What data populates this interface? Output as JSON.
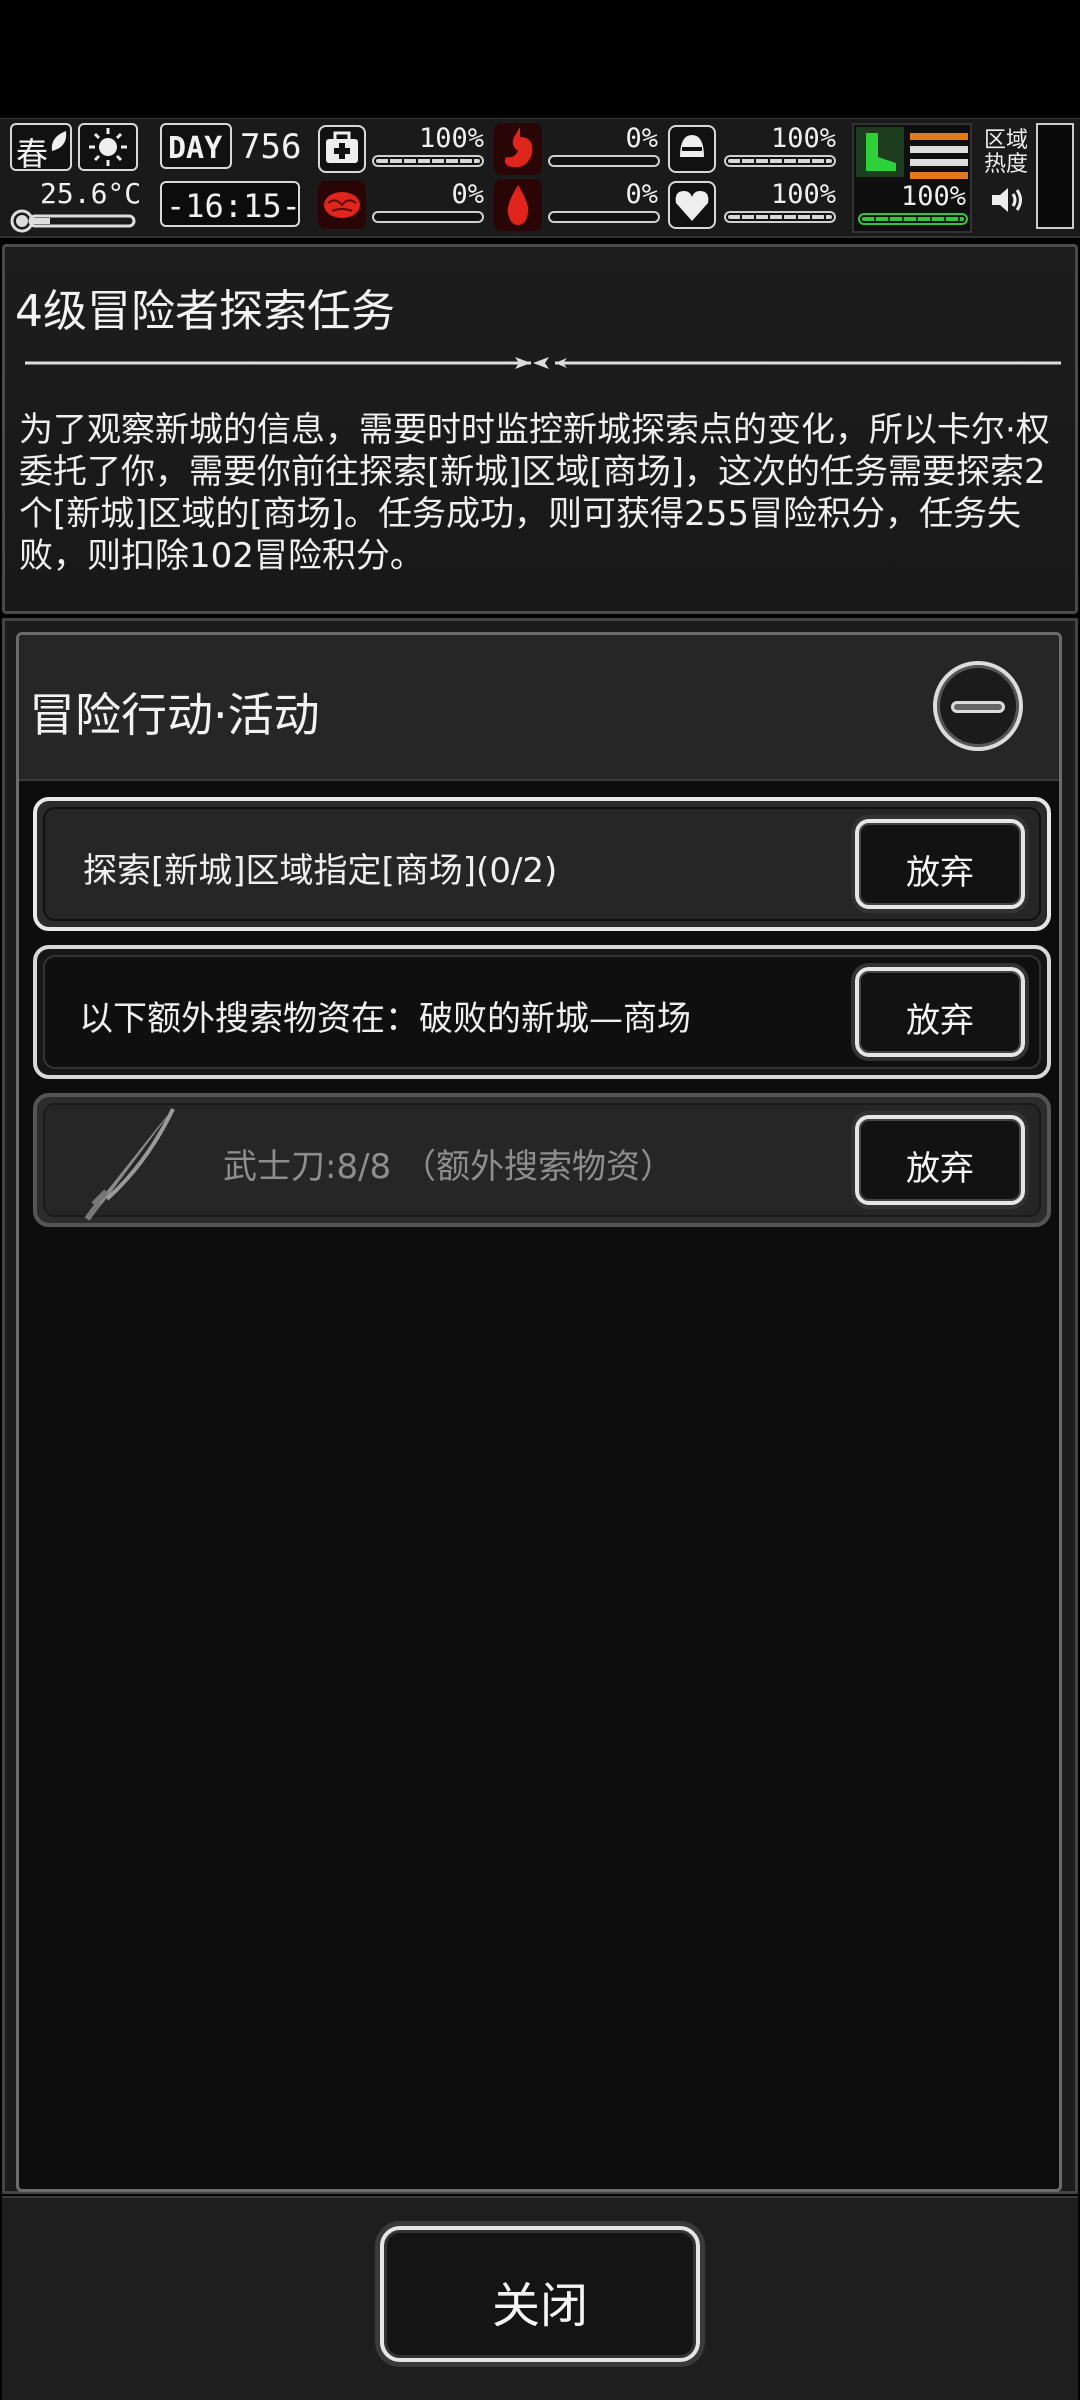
{
  "hud": {
    "season": "春",
    "day_badge": "DAY",
    "day": "756",
    "temperature": "25.6°C",
    "time": "-16:15-",
    "region_heat": "区域\n热度",
    "stats": {
      "health": "100%",
      "sanity": "0%",
      "hunger": "0%",
      "bleeding": "0%",
      "armor": "100%",
      "mood": "100%",
      "stamina": "100%"
    },
    "levels": {
      "health": 1.0,
      "sanity": 0.0,
      "hunger": 0.0,
      "bleeding": 0.0,
      "armor": 1.0,
      "mood": 1.0,
      "stamina": 1.0
    },
    "colors": {
      "red_icon": "#e0261c",
      "green_icon": "#2fd13a",
      "orange_bar": "#e07a1a",
      "accent_text": "#f2f2f2"
    },
    "icons": [
      "leaf-icon",
      "sun-icon",
      "thermometer-icon",
      "medkit-icon",
      "brain-icon",
      "stomach-icon",
      "blood-drop-icon",
      "helmet-icon",
      "heart-icon",
      "boot-icon",
      "speaker-icon"
    ]
  },
  "mission": {
    "title": "4级冒险者探索任务",
    "description": "为了观察新城的信息，需要时时监控新城探索点的变化，所以卡尔·权委托了你，需要你前往探索[新城]区域[商场]，这次的任务需要探索2个[新城]区域的[商场]。任务成功，则可获得255冒险积分，任务失败，则扣除102冒险积分。"
  },
  "activity": {
    "title": "冒险行动·活动",
    "tasks": [
      {
        "label": "探索[新城]区域指定[商场](0/2)",
        "button": "放弃"
      },
      {
        "label": "以下额外搜索物资在：破败的新城—商场",
        "button": "放弃"
      },
      {
        "label": "武士刀:8/8 （额外搜索物资）",
        "button": "放弃",
        "icon": "katana-icon"
      }
    ]
  },
  "footer": {
    "close_label": "关闭"
  }
}
